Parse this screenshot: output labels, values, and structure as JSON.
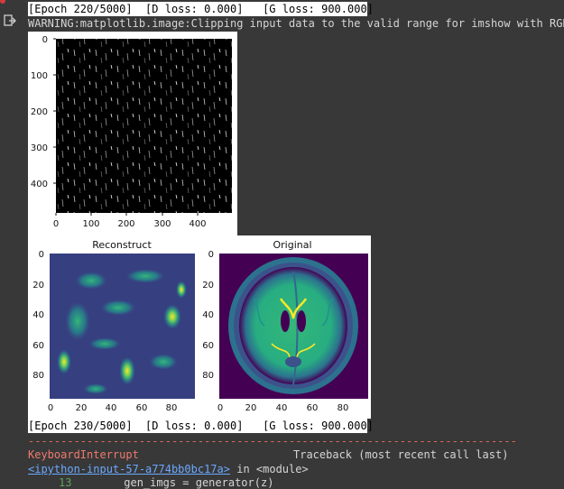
{
  "output": {
    "epoch_line_1": "[Epoch 220/5000]  [D loss: 0.000]   [G loss: 900.000]",
    "warning": "WARNING:matplotlib.image:Clipping input data to the valid range for imshow with RGB d",
    "epoch_line_2": "[Epoch 230/5000]  [D loss: 0.000]   [G loss: 900.000]",
    "separator": "---------------------------------------------------------------------------",
    "exception_name": "KeyboardInterrupt",
    "traceback_label": "Traceback (most recent call last)",
    "input_link": "<ipython-input-57-a774bb0bc17a>",
    "in_module": " in <module>",
    "code_line_number": "13",
    "code_line_text": "        gen_imgs = generator(z)"
  },
  "figure_top": {
    "y_ticks": [
      "0",
      "100",
      "200",
      "300",
      "400"
    ],
    "x_ticks": [
      "0",
      "100",
      "200",
      "300",
      "400"
    ]
  },
  "figure_reconstruct": {
    "title": "Reconstruct",
    "y_ticks": [
      "0",
      "20",
      "40",
      "60",
      "80"
    ],
    "x_ticks": [
      "0",
      "20",
      "40",
      "60",
      "80"
    ]
  },
  "figure_original": {
    "title": "Original",
    "y_ticks": [
      "0",
      "20",
      "40",
      "60",
      "80"
    ],
    "x_ticks": [
      "0",
      "20",
      "40",
      "60",
      "80"
    ]
  },
  "colors": {
    "page_bg": "#383838",
    "viridis_dark": "#440154",
    "viridis_mid": "#21918c",
    "viridis_bright": "#fde725",
    "error_red": "#ef7a6e",
    "link_blue": "#6aa9ff"
  },
  "icons": {
    "output_icon": "output-redirect-icon"
  }
}
